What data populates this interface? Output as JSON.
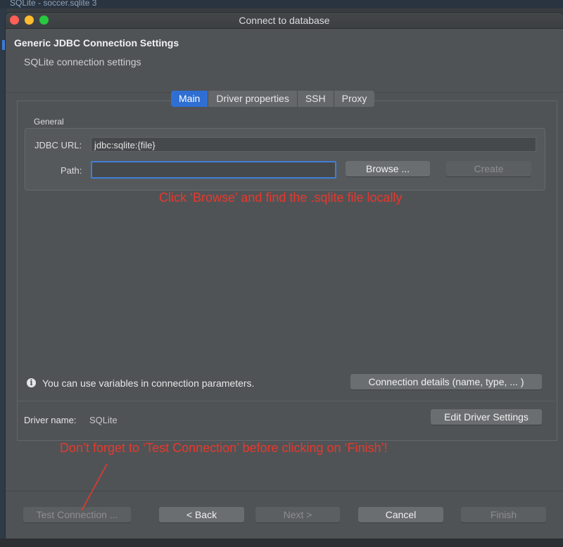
{
  "background": {
    "app_title": "SQLite - soccer.sqlite 3"
  },
  "window": {
    "title": "Connect to database"
  },
  "header": {
    "title": "Generic JDBC Connection Settings",
    "subtitle": "SQLite connection settings"
  },
  "tabs": [
    {
      "label": "Main",
      "active": true
    },
    {
      "label": "Driver properties",
      "active": false
    },
    {
      "label": "SSH",
      "active": false
    },
    {
      "label": "Proxy",
      "active": false
    }
  ],
  "general": {
    "group_label": "General",
    "jdbc_url_label": "JDBC URL:",
    "jdbc_url_value": "jdbc:sqlite:{file}",
    "path_label": "Path:",
    "path_value": "",
    "browse_label": "Browse ...",
    "create_label": "Create"
  },
  "annotations": {
    "browse_hint": "Click ‘Browse’ and find the .sqlite file locally",
    "test_hint": "Don’t forget to ‘Test Connection’ before clicking on ‘Finish’!"
  },
  "info": {
    "text": "You can use variables in connection parameters.",
    "details_button": "Connection details (name, type, ... )"
  },
  "driver": {
    "label": "Driver name:",
    "value": "SQLite",
    "edit_button": "Edit Driver Settings"
  },
  "footer": {
    "test_connection": "Test Connection ...",
    "back": "< Back",
    "next": "Next >",
    "cancel": "Cancel",
    "finish": "Finish"
  },
  "colors": {
    "accent": "#2f6fd3",
    "annotation": "#e8382c",
    "window_bg": "#505356"
  }
}
